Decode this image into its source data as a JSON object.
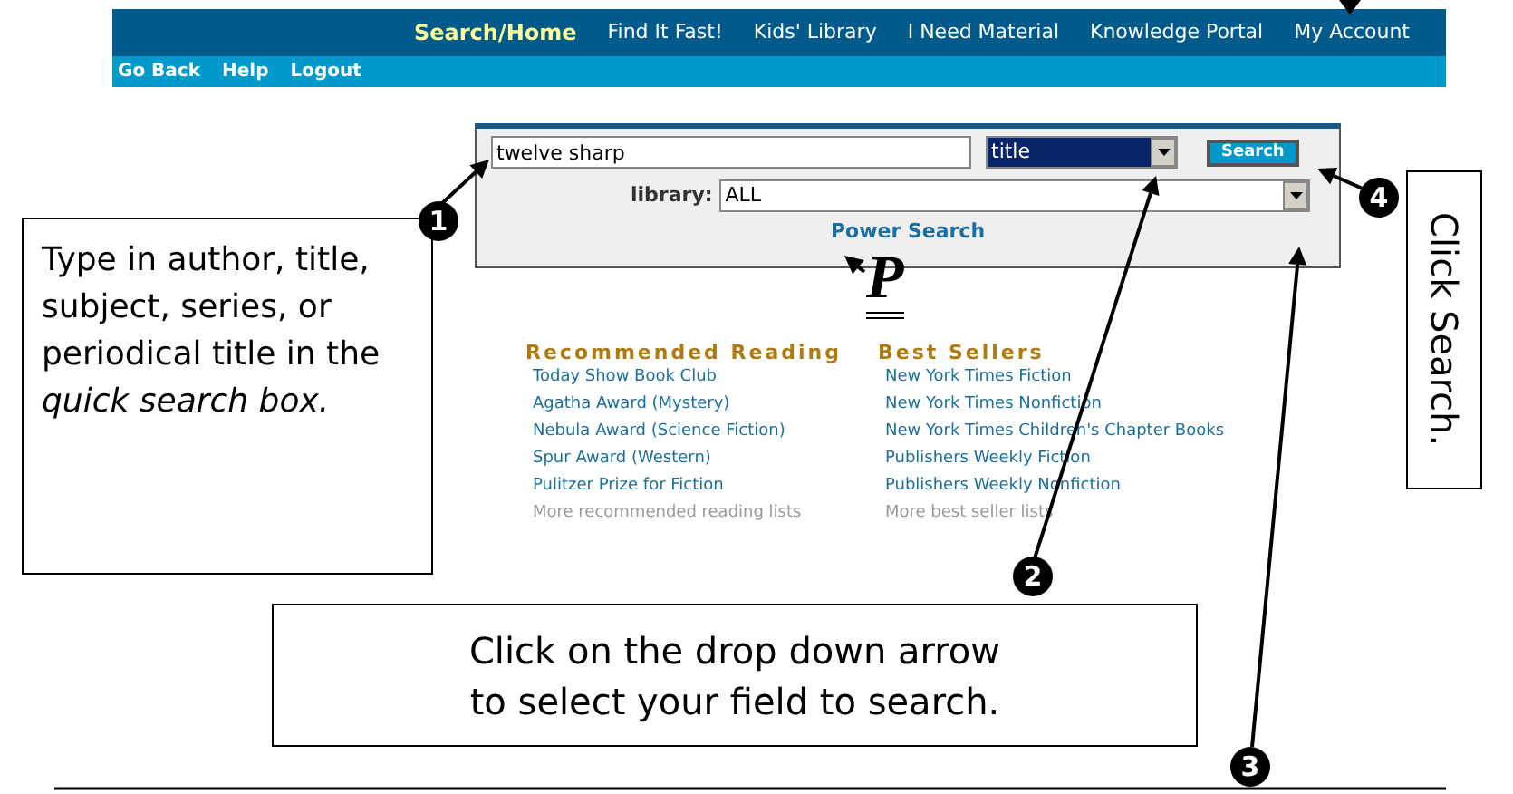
{
  "nav": [
    {
      "label": "Search/Home",
      "selected": true
    },
    {
      "label": "Find It Fast!",
      "selected": false
    },
    {
      "label": "Kids' Library",
      "selected": false
    },
    {
      "label": "I Need Material",
      "selected": false
    },
    {
      "label": "Knowledge Portal",
      "selected": false
    },
    {
      "label": "My Account",
      "selected": false
    }
  ],
  "subnav": [
    "Go Back",
    "Help",
    "Logout"
  ],
  "search": {
    "query": "twelve sharp",
    "field": "title",
    "button": "Search",
    "library_label": "library:",
    "library": "ALL",
    "power_search": "Power Search"
  },
  "power_icon": "P",
  "lists": [
    {
      "heading": "Recommended Reading",
      "links": [
        "Today Show Book Club",
        "Agatha Award (Mystery)",
        "Nebula Award (Science Fiction)",
        "Spur Award (Western)",
        "Pulitzer Prize for Fiction"
      ],
      "more": "More recommended reading lists"
    },
    {
      "heading": "Best Sellers",
      "links": [
        "New York Times Fiction",
        "New York Times Nonfiction",
        "New York Times Children's Chapter Books",
        "Publishers Weekly Fiction",
        "Publishers Weekly Nonfiction"
      ],
      "more": "More best seller lists"
    }
  ],
  "callouts": [
    {
      "number": "1",
      "text": "Type in author, title, subject, series, or periodical title in the *quick search box.*"
    },
    {
      "number": "2",
      "text": "Click on the drop down arrow to select your field to search."
    },
    {
      "number": "3"
    },
    {
      "number": "4",
      "text": "Click Search."
    }
  ]
}
